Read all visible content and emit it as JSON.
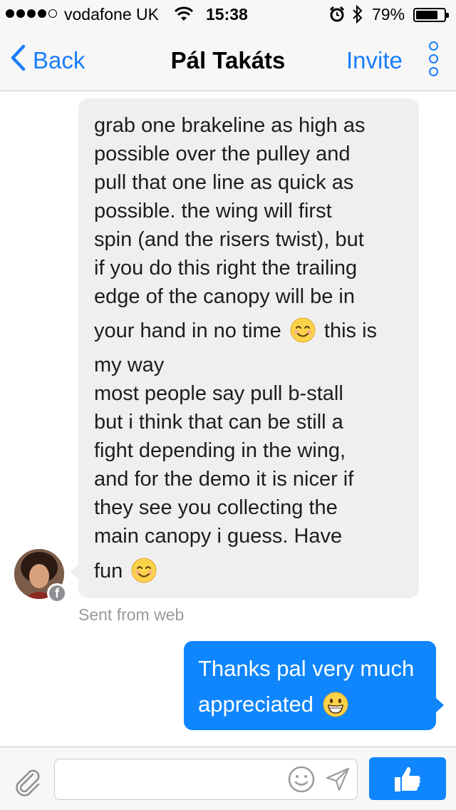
{
  "status_bar": {
    "carrier": "vodafone UK",
    "time": "15:38",
    "battery_percent_label": "79%",
    "battery_level": 0.79,
    "signal_bars_filled": 4,
    "signal_bars_total": 5,
    "icons": [
      "wifi-icon",
      "alarm-icon",
      "bluetooth-icon",
      "battery-icon"
    ]
  },
  "nav": {
    "back_label": "Back",
    "title": "Pál Takáts",
    "invite_label": "Invite"
  },
  "conversation": {
    "incoming_lines": [
      "grab one brakeline as high as",
      "possible over the pulley and",
      "pull that one line as quick as",
      "possible. the wing will first",
      "spin (and the risers twist), but",
      "if you do this right the trailing",
      "edge of the canopy will be in",
      "your hand in no time",
      "this is",
      "my way",
      "most people say pull b-stall",
      "but i think that can be still a",
      "fight depending in the wing,",
      "and for the demo it is nicer if",
      "they see you collecting the",
      "main canopy i guess. Have",
      "fun"
    ],
    "sent_from": "Sent from web",
    "outgoing_lines": [
      "Thanks pal very much",
      "appreciated"
    ]
  },
  "composer": {
    "value": "",
    "placeholder": ""
  },
  "colors": {
    "accent": "#1a7dfb",
    "outgoing_bubble": "#0f86fd",
    "incoming_bubble": "#f0eff0",
    "bar_background": "#f7f7f8"
  }
}
